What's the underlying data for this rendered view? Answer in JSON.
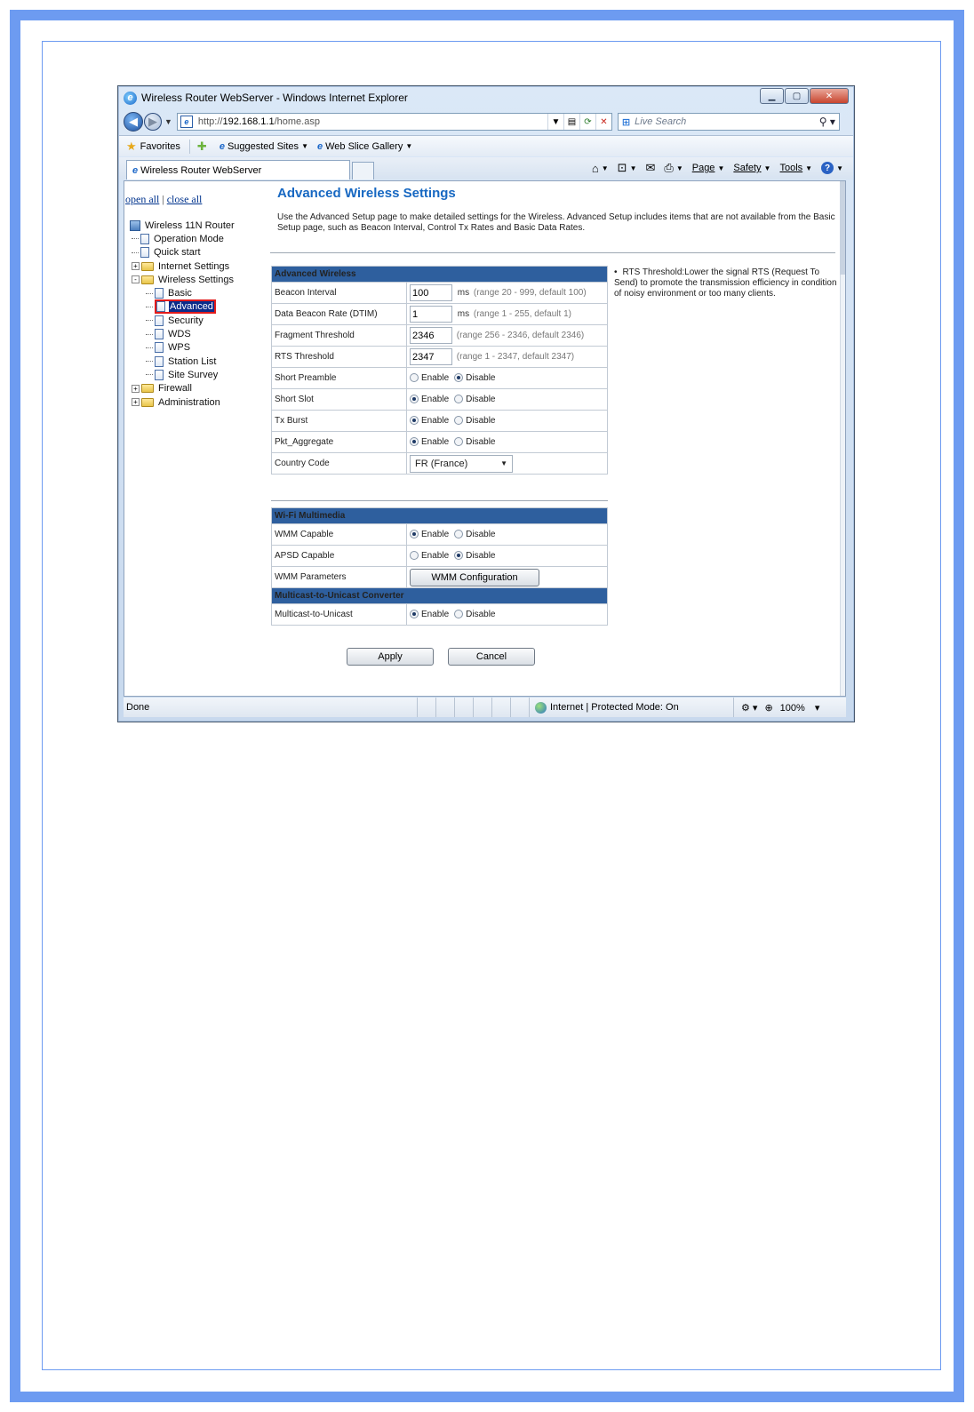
{
  "window": {
    "title": "Wireless Router WebServer - Windows Internet Explorer",
    "address_prefix": "http://",
    "address_host": "192.168.1.1",
    "address_path": "/home.asp",
    "search_placeholder": "Live Search",
    "tab_title": "Wireless Router WebServer"
  },
  "favorites": {
    "favorites_label": "Favorites",
    "suggested_sites": "Suggested Sites",
    "web_slice_gallery": "Web Slice Gallery"
  },
  "commands": {
    "page": "Page",
    "safety": "Safety",
    "tools": "Tools"
  },
  "sidebar": {
    "open_all": "open all",
    "separator": "|",
    "close_all": "close all",
    "tree": [
      {
        "label": "Wireless 11N Router",
        "depth": 0,
        "icon": "router-icon"
      },
      {
        "label": "Operation Mode",
        "depth": 1,
        "icon": "doc-icon"
      },
      {
        "label": "Quick start",
        "depth": 1,
        "icon": "doc-icon"
      },
      {
        "label": "Internet Settings",
        "depth": 1,
        "icon": "folder-icon",
        "expander": "+"
      },
      {
        "label": "Wireless Settings",
        "depth": 1,
        "icon": "folder-icon",
        "expander": "-"
      },
      {
        "label": "Basic",
        "depth": 2,
        "icon": "doc-icon"
      },
      {
        "label": "Advanced",
        "depth": 2,
        "icon": "doc-icon",
        "selected": true
      },
      {
        "label": "Security",
        "depth": 2,
        "icon": "doc-icon"
      },
      {
        "label": "WDS",
        "depth": 2,
        "icon": "doc-icon"
      },
      {
        "label": "WPS",
        "depth": 2,
        "icon": "doc-icon"
      },
      {
        "label": "Station List",
        "depth": 2,
        "icon": "doc-icon"
      },
      {
        "label": "Site Survey",
        "depth": 2,
        "icon": "doc-icon"
      },
      {
        "label": "Firewall",
        "depth": 1,
        "icon": "folder-icon",
        "expander": "+"
      },
      {
        "label": "Administration",
        "depth": 1,
        "icon": "folder-icon",
        "expander": "+"
      }
    ]
  },
  "main": {
    "title": "Advanced Wireless Settings",
    "intro": "Use the Advanced Setup page to make detailed settings for the Wireless. Advanced Setup includes items that are not available from the Basic Setup page, such as Beacon Interval, Control Tx Rates and Basic Data Rates.",
    "advanced_wireless": {
      "header": "Advanced Wireless",
      "beacon_interval": {
        "label": "Beacon Interval",
        "value": "100",
        "unit": "ms",
        "range": "(range 20 - 999, default 100)"
      },
      "dtim": {
        "label": "Data Beacon Rate (DTIM)",
        "value": "1",
        "unit": "ms",
        "range": "(range 1 - 255, default 1)"
      },
      "fragment": {
        "label": "Fragment Threshold",
        "value": "2346",
        "range": "(range 256 - 2346, default 2346)"
      },
      "rts": {
        "label": "RTS Threshold",
        "value": "2347",
        "range": "(range 1 - 2347, default 2347)"
      },
      "short_preamble": {
        "label": "Short Preamble",
        "selected": "Disable"
      },
      "short_slot": {
        "label": "Short Slot",
        "selected": "Enable"
      },
      "tx_burst": {
        "label": "Tx Burst",
        "selected": "Enable"
      },
      "pkt_aggregate": {
        "label": "Pkt_Aggregate",
        "selected": "Enable"
      },
      "country_code": {
        "label": "Country Code",
        "value": "FR (France)"
      }
    },
    "wifi_multimedia": {
      "header": "Wi-Fi Multimedia",
      "wmm_capable": {
        "label": "WMM Capable",
        "selected": "Enable"
      },
      "apsd_capable": {
        "label": "APSD Capable",
        "selected": "Disable"
      },
      "wmm_parameters": {
        "label": "WMM Parameters",
        "button": "WMM Configuration"
      }
    },
    "multicast": {
      "header": "Multicast-to-Unicast Converter",
      "row": {
        "label": "Multicast-to-Unicast",
        "selected": "Enable"
      }
    },
    "radio_enable": "Enable",
    "radio_disable": "Disable",
    "apply": "Apply",
    "cancel": "Cancel",
    "help_bullet": "•",
    "help_text": "RTS Threshold:Lower the signal RTS (Request To Send) to promote the transmission efficiency in condition of noisy environment or too many clients."
  },
  "status": {
    "text": "Done",
    "zone": "Internet | Protected Mode: On",
    "zoom": "100%"
  },
  "colors": {
    "page_border": "#6d9bf1",
    "section_header": "#2e5f9e",
    "title_blue": "#1768c2",
    "highlight_red": "#e21b1b"
  }
}
